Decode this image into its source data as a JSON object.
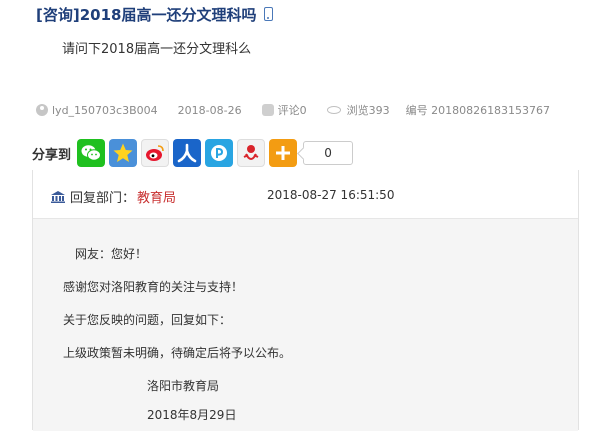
{
  "question": {
    "title": "[咨询]2018届高一还分文理科吗",
    "body": "请问下2018届高一还分文理科么"
  },
  "meta": {
    "user": "lyd_150703c3B004",
    "date": "2018-08-26",
    "comments": "评论0",
    "views": "浏览393",
    "serial": "编号 20180826183153767"
  },
  "share": {
    "label": "分享到",
    "count": "0"
  },
  "reply": {
    "dept_label": "回复部门：",
    "dept_name": "教育局",
    "time": "2018-08-27 16:51:50",
    "greeting": "网友：您好！",
    "thanks": "感谢您对洛阳教育的关注与支持！",
    "intro": "关于您反映的问题，回复如下：",
    "content": "上级政策暂未明确，待确定后将予以公布。",
    "signature": "洛阳市教育局",
    "sign_date": "2018年8月29日"
  }
}
